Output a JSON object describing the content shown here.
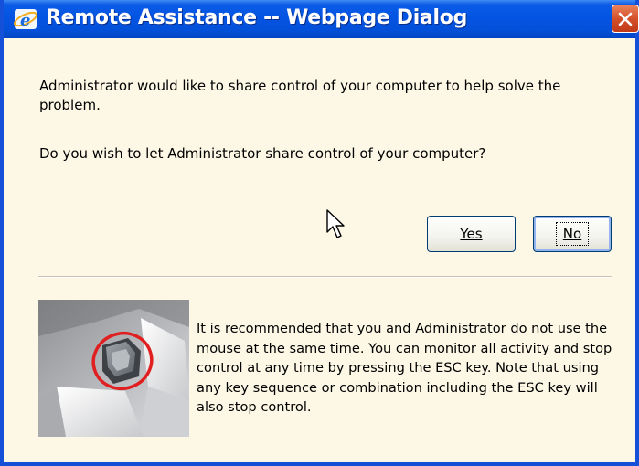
{
  "window": {
    "title": "Remote Assistance -- Webpage Dialog",
    "icon": "ie-icon",
    "close_icon": "close-icon"
  },
  "message": {
    "line1": "Administrator would like to share control of your computer to help solve the problem.",
    "line2": "Do you wish to let Administrator share control of your computer?"
  },
  "buttons": {
    "yes": {
      "label": "Yes",
      "mnemonic": "Y"
    },
    "no": {
      "label": "No",
      "mnemonic": "N",
      "default": true
    }
  },
  "note": {
    "text": "It is recommended that you and Administrator  do not use the mouse at the same time. You can monitor all activity and stop control at any time by pressing the ESC key. Note that using any key sequence or combination including the ESC key will also stop control."
  },
  "illustration": {
    "name": "esc-key-photo",
    "highlight": "red-circle"
  },
  "colors": {
    "titlebar": "#0454e4",
    "dialog_bg": "#fdf8e6",
    "close_button": "#d4502a",
    "button_border": "#003c74",
    "highlight_circle": "#e02020"
  }
}
